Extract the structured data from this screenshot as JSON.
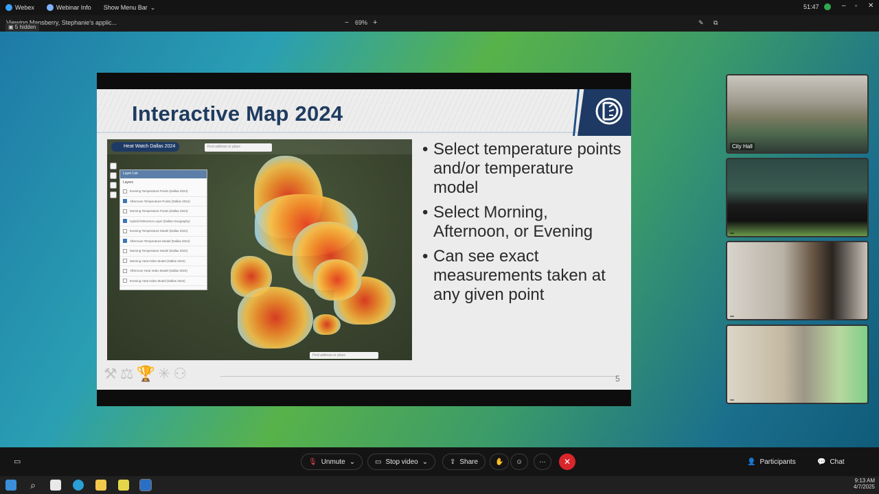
{
  "titlebar": {
    "app": "Webex",
    "webinar_info": "Webinar Info",
    "show_menu": "Show Menu Bar",
    "clock": "51:47"
  },
  "subbar": {
    "viewing": "Viewing Mansberry, Stephanie's applic...",
    "hidden": "5 hidden",
    "zoom": "69%",
    "zoom_minus": "−",
    "zoom_plus": "+"
  },
  "slide": {
    "title": "Interactive Map 2024",
    "page_number": "5",
    "bullets": [
      "Select temperature points and/or temperature model",
      "Select Morning, Afternoon, or Evening",
      "Can see exact measurements taken at any given point"
    ],
    "map": {
      "app_name": "Heat Watch Dallas 2024",
      "search_placeholder": "Find address or place",
      "bottom_search": "Find address or place",
      "panel_title": "Layer List",
      "panel_subtitle": "Layers",
      "layers": [
        {
          "label": "Evening Temperature Points (Dallas 2024)",
          "checked": false
        },
        {
          "label": "Afternoon Temperature Points (Dallas 2024)",
          "checked": true
        },
        {
          "label": "Morning Temperature Points (Dallas 2024)",
          "checked": false
        },
        {
          "label": "Hybrid Reference Layer (Dallas Geography)",
          "checked": true
        },
        {
          "label": "Evening Temperature Model (Dallas 2024)",
          "checked": false
        },
        {
          "label": "Afternoon Temperature Model (Dallas 2024)",
          "checked": true
        },
        {
          "label": "Morning Temperature Model (Dallas 2024)",
          "checked": false
        },
        {
          "label": "Morning Heat Index Model (Dallas 2024)",
          "checked": false
        },
        {
          "label": "Afternoon Heat Index Model (Dallas 2024)",
          "checked": false
        },
        {
          "label": "Evening Heat Index Model (Dallas 2024)",
          "checked": false
        }
      ]
    }
  },
  "videos": [
    {
      "label": "City Hall"
    },
    {
      "label": ""
    },
    {
      "label": ""
    },
    {
      "label": ""
    }
  ],
  "controls": {
    "unmute": "Unmute",
    "stop_video": "Stop video",
    "share": "Share",
    "more": "···",
    "participants": "Participants",
    "chat": "Chat"
  },
  "taskbar": {
    "time": "9:13 AM",
    "date": "4/7/2025"
  },
  "colors": {
    "slide_title": "#1f3b5f",
    "end_call": "#d9262b",
    "brand": "#1e3a64"
  }
}
